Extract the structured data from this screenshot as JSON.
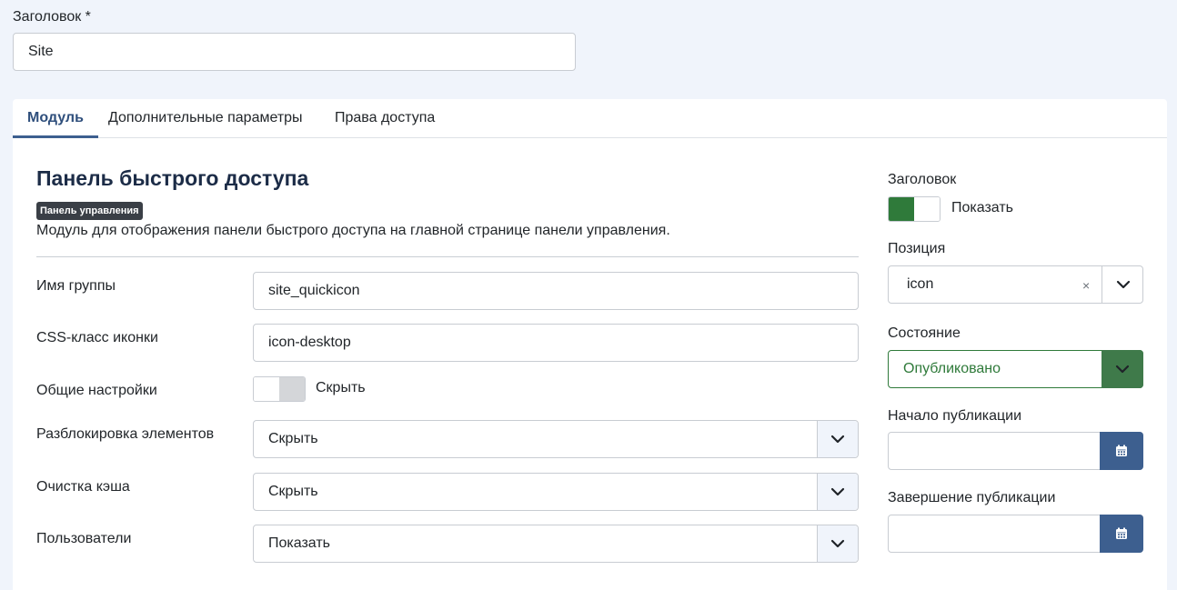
{
  "title": {
    "label": "Заголовок *",
    "value": "Site"
  },
  "tabs": [
    {
      "label": "Модуль",
      "active": true
    },
    {
      "label": "Дополнительные параметры",
      "active": false
    },
    {
      "label": "Права доступа",
      "active": false
    }
  ],
  "module": {
    "title": "Панель быстрого доступа",
    "badge": "Панель управления",
    "description": "Модуль для отображения панели быстрого доступа на главной странице панели управления."
  },
  "form": {
    "group_name": {
      "label": "Имя группы",
      "value": "site_quickicon"
    },
    "icon_class": {
      "label": "CSS-класс иконки",
      "value": "icon-desktop"
    },
    "general_settings": {
      "label": "Общие настройки",
      "value": "Скрыть"
    },
    "unlock_items": {
      "label": "Разблокировка элементов",
      "value": "Скрыть"
    },
    "clear_cache": {
      "label": "Очистка кэша",
      "value": "Скрыть"
    },
    "users": {
      "label": "Пользователи",
      "value": "Показать"
    }
  },
  "sidebar": {
    "show_title": {
      "label": "Заголовок",
      "value": "Показать"
    },
    "position": {
      "label": "Позиция",
      "value": "icon",
      "clear": "×"
    },
    "state": {
      "label": "Состояние",
      "value": "Опубликовано"
    },
    "publish_up": {
      "label": "Начало публикации",
      "value": ""
    },
    "publish_down": {
      "label": "Завершение публикации",
      "value": ""
    }
  },
  "colors": {
    "accent": "#3d5f8f",
    "success": "#2f7a3a",
    "background": "#f0f4fb"
  }
}
